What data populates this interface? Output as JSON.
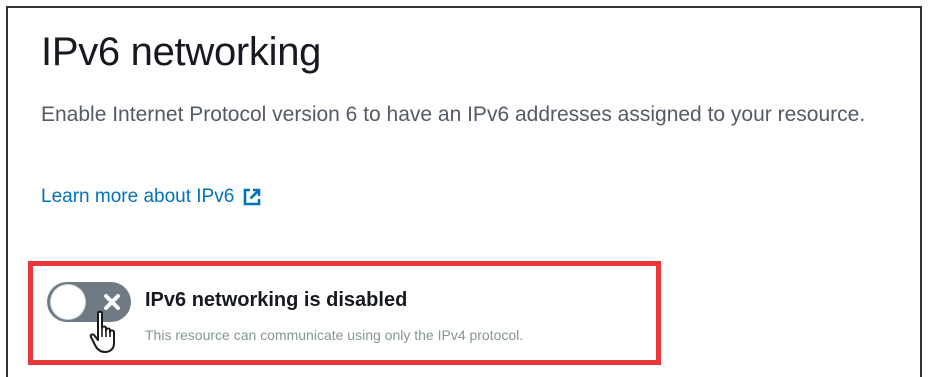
{
  "section": {
    "title": "IPv6 networking",
    "description": "Enable Internet Protocol version 6 to have an IPv6 addresses assigned to your resource.",
    "learn_more": {
      "label": "Learn more about IPv6",
      "icon": "external-link-icon"
    }
  },
  "toggle": {
    "state": "off",
    "label": "IPv6 networking is disabled",
    "description": "This resource can communicate using only the IPv4 protocol.",
    "icon": "x-icon"
  },
  "colors": {
    "link": "#0073bb",
    "toggle_off": "#6f7a84",
    "highlight": "#e8383d"
  }
}
